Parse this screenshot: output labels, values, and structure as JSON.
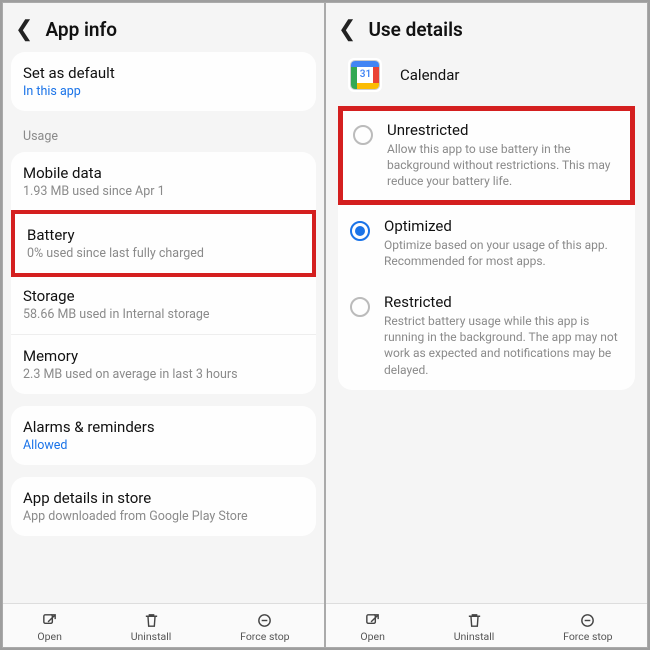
{
  "left": {
    "title": "App info",
    "default": {
      "title": "Set as default",
      "sub": "In this app"
    },
    "usage_label": "Usage",
    "mobile_data": {
      "title": "Mobile data",
      "sub": "1.93 MB used since Apr 1"
    },
    "battery": {
      "title": "Battery",
      "sub": "0% used since last fully charged"
    },
    "storage": {
      "title": "Storage",
      "sub": "58.66 MB used in Internal storage"
    },
    "memory": {
      "title": "Memory",
      "sub": "2.3 MB used on average in last 3 hours"
    },
    "alarms": {
      "title": "Alarms & reminders",
      "sub": "Allowed"
    },
    "store": {
      "title": "App details in store",
      "sub": "App downloaded from Google Play Store"
    }
  },
  "right": {
    "title": "Use details",
    "app_name": "Calendar",
    "cal_day": "31",
    "unrestricted": {
      "title": "Unrestricted",
      "sub": "Allow this app to use battery in the background without restrictions. This may reduce your battery life."
    },
    "optimized": {
      "title": "Optimized",
      "sub": "Optimize based on your usage of this app. Recommended for most apps."
    },
    "restricted": {
      "title": "Restricted",
      "sub": "Restrict battery usage while this app is running in the background. The app may not work as expected and notifications may be delayed."
    }
  },
  "bottom": {
    "open": "Open",
    "uninstall": "Uninstall",
    "force": "Force stop"
  }
}
